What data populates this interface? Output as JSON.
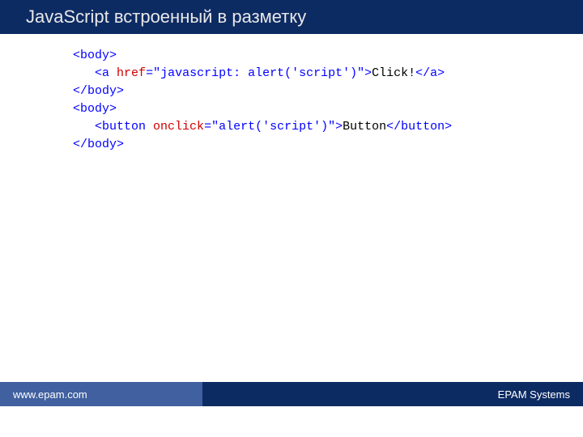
{
  "title": "JavaScript встроенный в разметку",
  "code": {
    "line1": {
      "open": "<body>"
    },
    "line2": {
      "open1": "<a",
      "sp1": " ",
      "attr": "href",
      "eq": "=",
      "str": "\"javascript: alert('script')\"",
      "close1": ">",
      "text": "Click!",
      "close2": "</a>"
    },
    "line3": {
      "close": "</body>"
    },
    "line4": {
      "open": "<body>"
    },
    "line5": {
      "open1": "<button",
      "sp1": " ",
      "attr": "onclick",
      "eq": "=",
      "str": "\"alert('script')\"",
      "close1": ">",
      "text": "Button",
      "close2": "</button>"
    },
    "line6": {
      "close": "</body>"
    }
  },
  "footer": {
    "left": "www.epam.com",
    "right": "EPAM Systems"
  }
}
